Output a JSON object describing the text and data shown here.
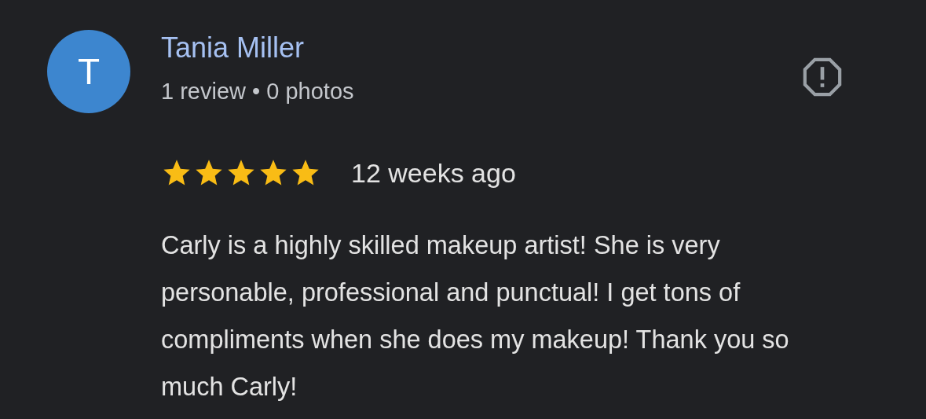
{
  "reviewer": {
    "avatar_letter": "T",
    "name": "Tania Miller",
    "stats": "1 review • 0 photos"
  },
  "review": {
    "stars": 5,
    "time": "12 weeks ago",
    "text": "Carly is a highly skilled makeup artist! She is very personable, professional and punctual! I get tons of compliments when she does my makeup! Thank you so much Carly!"
  }
}
